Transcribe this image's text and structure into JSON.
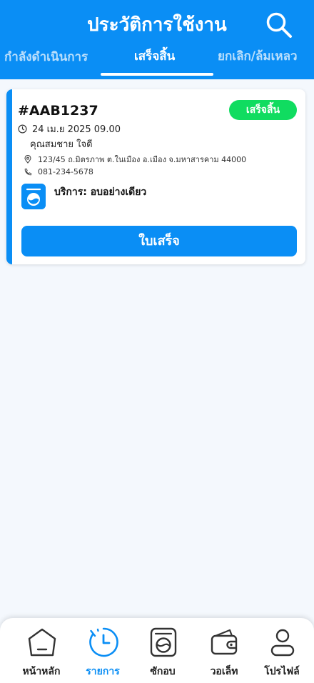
{
  "header": {
    "title": "ประวัติการใช้งาน",
    "tabs": [
      {
        "label": "กำลังดำเนินการ",
        "active": false
      },
      {
        "label": "เสร็จสิ้น",
        "active": true
      },
      {
        "label": "ยกเลิก/ล้มเหลว",
        "active": false
      }
    ]
  },
  "order": {
    "id": "#AAB1237",
    "status": "เสร็จสิ้น",
    "datetime": "24 เม.ย 2025 09.00",
    "customer": "คุณสมชาย ใจดี",
    "address": "123/45 ถ.มิตรภาพ ต.ในเมือง อ.เมือง จ.มหาสารคาม 44000",
    "phone": "081-234-5678",
    "service": "บริการ: อบอย่างเดียว",
    "receipt_button": "ใบเสร็จ"
  },
  "nav": {
    "items": [
      {
        "label": "หน้าหลัก",
        "icon": "home-icon",
        "active": false
      },
      {
        "label": "รายการ",
        "icon": "clock-icon",
        "active": true
      },
      {
        "label": "ซักอบ",
        "icon": "washing-machine-icon",
        "active": false
      },
      {
        "label": "วอเล็ท",
        "icon": "wallet-icon",
        "active": false
      },
      {
        "label": "โปรไฟล์",
        "icon": "profile-icon",
        "active": false
      }
    ]
  },
  "colors": {
    "primary": "#0a8ef5",
    "status_done": "#10dc60",
    "background": "#f4f8fd"
  }
}
